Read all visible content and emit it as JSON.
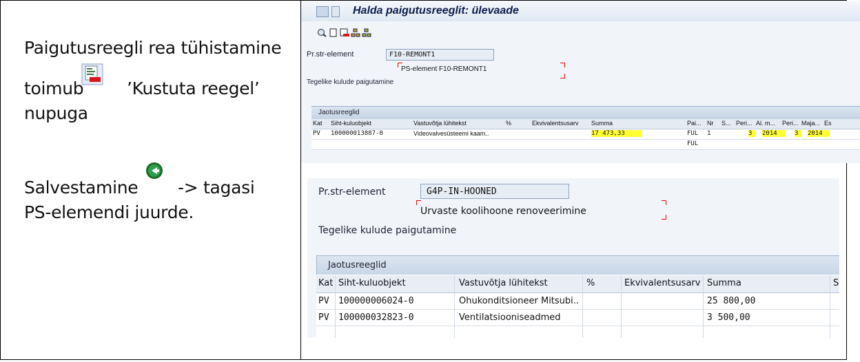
{
  "left": {
    "line1": "Paigutusreegli rea tühistamine",
    "line2_pre": "toimub",
    "line2_post": "’Kustuta reegel’",
    "line3": "nupuga",
    "save_pre": "Salvestamine",
    "save_post": "-> tagasi",
    "save_line2": "PS-elemendi juurde."
  },
  "sap1": {
    "title": "Halda paigutusreeglit: ülevaade",
    "prstr_label": "Pr.str-element",
    "prstr_value": "F10-REMONT1",
    "desc_value": "PS-element F10-REMONT1",
    "section_label": "Tegelike kulude paigutamine",
    "table_title": "Jaotusreeglid",
    "columns": [
      "Kat",
      "Siht-kuluobjekt",
      "Vastuvõtja lühitekst",
      "%",
      "Ekvivalentsusarv",
      "Summa",
      "Pai...",
      "Nr",
      "S...",
      "Peri...",
      "Al. m...",
      "Peri...",
      "Maja...",
      "Es"
    ],
    "rows": [
      {
        "kat": "PV",
        "obj": "100000013887-0",
        "text": "Videovalvesüsteemi kaam..",
        "summa": "17 473,33",
        "pai": "FUL",
        "nr": "1",
        "peri": "3",
        "alm": "2014",
        "peri2": "3",
        "maja": "2014"
      },
      {
        "kat": "",
        "obj": "",
        "text": "",
        "summa": "",
        "pai": "FUL",
        "nr": "",
        "peri": "",
        "alm": "",
        "peri2": "",
        "maja": ""
      }
    ]
  },
  "sap2": {
    "prstr_label": "Pr.str-element",
    "prstr_value": "G4P-IN-HOONED",
    "desc_value": "Urvaste koolihoone renoveerimine",
    "section_label": "Tegelike kulude paigutamine",
    "table_title": "Jaotusreeglid",
    "columns": [
      "Kat",
      "Siht-kuluobjekt",
      "Vastuvõtja lühitekst",
      "%",
      "Ekvivalentsusarv",
      "Summa",
      "S"
    ],
    "rows": [
      {
        "kat": "PV",
        "obj": "100000006024-0",
        "text": "Õhukonditsioneer Mitsubi..",
        "summa": "25 800,00"
      },
      {
        "kat": "PV",
        "obj": "100000032823-0",
        "text": "Ventilatsiooniseadmed",
        "summa": "3 500,00"
      }
    ]
  },
  "icons": {
    "delete_rule": "delete-rule-icon",
    "save": "back-save-icon"
  }
}
